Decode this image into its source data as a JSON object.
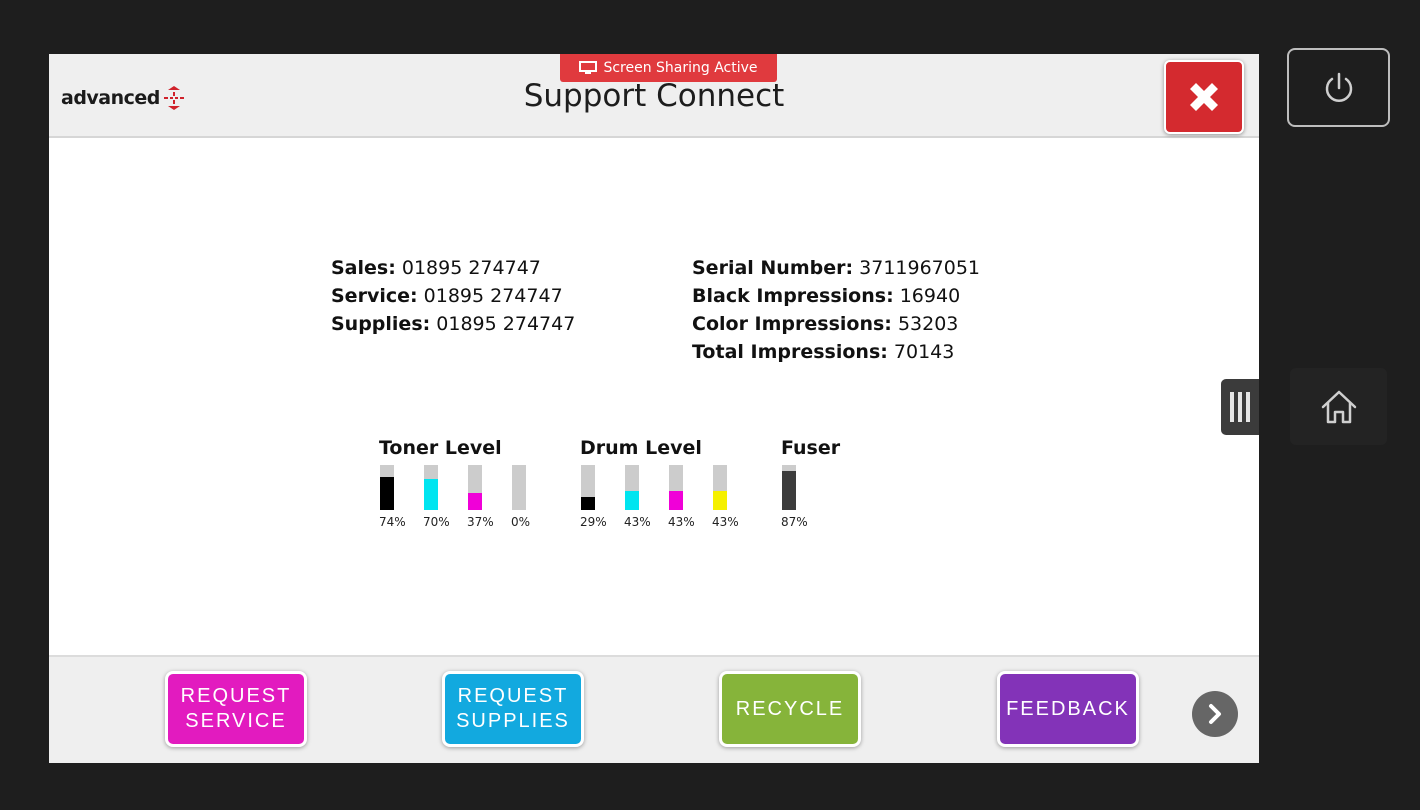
{
  "header": {
    "brand": "advanced",
    "title": "Support Connect",
    "share_badge": "Screen Sharing Active"
  },
  "contacts": [
    {
      "label": "Sales:",
      "value": "01895 274747"
    },
    {
      "label": "Service:",
      "value": "01895 274747"
    },
    {
      "label": "Supplies:",
      "value": "01895 274747"
    }
  ],
  "device": [
    {
      "label": "Serial Number:",
      "value": "3711967051"
    },
    {
      "label": "Black Impressions:",
      "value": "16940"
    },
    {
      "label": "Color Impressions:",
      "value": "53203"
    },
    {
      "label": "Total Impressions:",
      "value": "70143"
    }
  ],
  "levels": {
    "toner": {
      "title": "Toner Level",
      "items": [
        {
          "color": "#000000",
          "percent": 74,
          "label": "74%"
        },
        {
          "color": "#00e5f0",
          "percent": 70,
          "label": "70%"
        },
        {
          "color": "#f000d8",
          "percent": 37,
          "label": "37%"
        },
        {
          "color": "#f5f000",
          "percent": 0,
          "label": "0%"
        }
      ]
    },
    "drum": {
      "title": "Drum Level",
      "items": [
        {
          "color": "#000000",
          "percent": 29,
          "label": "29%"
        },
        {
          "color": "#00e5f0",
          "percent": 43,
          "label": "43%"
        },
        {
          "color": "#f000d8",
          "percent": 43,
          "label": "43%"
        },
        {
          "color": "#f5f000",
          "percent": 43,
          "label": "43%"
        }
      ]
    },
    "fuser": {
      "title": "Fuser",
      "items": [
        {
          "color": "#3c3c3c",
          "percent": 87,
          "label": "87%"
        }
      ]
    }
  },
  "actions": [
    {
      "label": "REQUEST\nSERVICE",
      "color": "#e21bbf"
    },
    {
      "label": "REQUEST\nSUPPLIES",
      "color": "#12a9df"
    },
    {
      "label": "RECYCLE",
      "color": "#86b43a"
    },
    {
      "label": "FEEDBACK",
      "color": "#8333b8"
    }
  ],
  "icons": {
    "close": "close-icon",
    "next": "chevron-right-icon",
    "power": "power-icon",
    "home": "home-icon",
    "handle": "panel-handle-icon",
    "share": "screen-share-icon"
  }
}
